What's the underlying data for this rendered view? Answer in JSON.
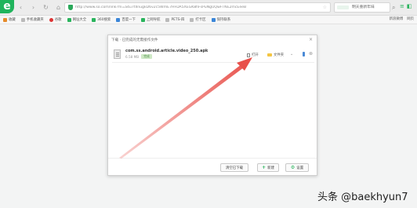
{
  "browser": {
    "logo_text": "e",
    "nav": {
      "back": "‹",
      "forward": "›",
      "reload": "↻",
      "home": "⌂"
    },
    "url": "http://www.so.com/link?m=a4u7tlInugkD6v2c5WmE7HFDA5XEGK8hFsPuNgUQwFTNE2mcEeeB",
    "search_placeholder": "明天重新年味",
    "search_icon": "search-icon",
    "accent_color": "#2ab45d"
  },
  "bookmarks": {
    "items": [
      {
        "label": "收藏",
        "icon": "star-icon"
      },
      {
        "label": "手机收藏夹",
        "icon": "phone-icon"
      },
      {
        "label": "谷歌",
        "icon": "google-icon"
      },
      {
        "label": "网址大全",
        "icon": "globe-icon"
      },
      {
        "label": "360搜索",
        "icon": "search-icon"
      },
      {
        "label": "百度一下",
        "icon": "baidu-icon"
      },
      {
        "label": "上网导航",
        "icon": "nav-icon"
      },
      {
        "label": "PETS-四",
        "icon": "doc-icon"
      },
      {
        "label": "打卡区",
        "icon": "doc-icon"
      },
      {
        "label": "保持联系",
        "icon": "doc-icon"
      }
    ],
    "right_items": [
      "新浪微博",
      "网页"
    ]
  },
  "download_dialog": {
    "title": "下载 · 已完成的无需接作文件",
    "close": "×",
    "file": {
      "name": "com.ss.android.article.video_250.apk",
      "size": "6.58 MB",
      "status": "完成",
      "open_label": "打开",
      "folder_label": "文件夹",
      "more": "⌄",
      "delete": "⊗"
    },
    "footer": {
      "clear_label": "清空已下载",
      "new_label": "新建",
      "settings_label": "设置"
    }
  },
  "annotation": {
    "color": "#e8504a"
  },
  "watermark": "头条 @baekhyun7"
}
